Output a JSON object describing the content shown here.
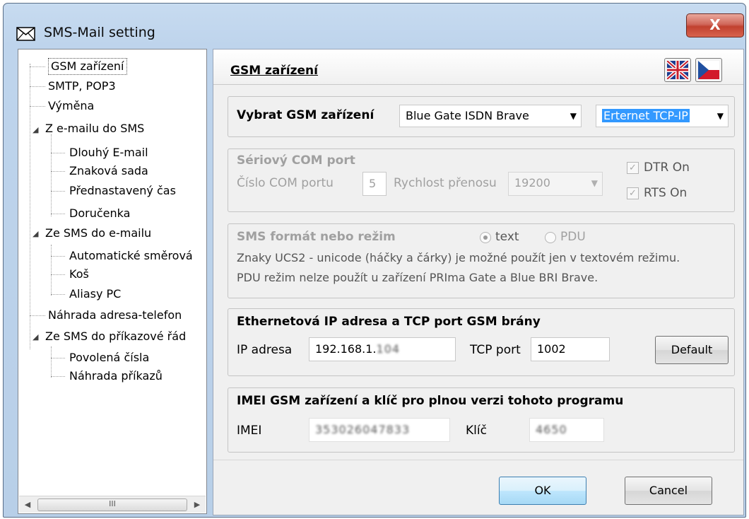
{
  "window": {
    "title": "SMS-Mail setting",
    "close_label": "X"
  },
  "tree": {
    "items": [
      {
        "label": "GSM zařízení"
      },
      {
        "label": "SMTP, POP3"
      },
      {
        "label": "Výměna"
      },
      {
        "label": "Z e-mailu do SMS"
      },
      {
        "label": "Dlouhý E-mail"
      },
      {
        "label": "Znaková sada"
      },
      {
        "label": "Přednastavený čas"
      },
      {
        "label": "Doručenka"
      },
      {
        "label": "Ze SMS do e-mailu"
      },
      {
        "label": "Automatické směrová"
      },
      {
        "label": "Koš"
      },
      {
        "label": "Aliasy PC"
      },
      {
        "label": "Náhrada adresa-telefon"
      },
      {
        "label": "Ze SMS do příkazové řád"
      },
      {
        "label": "Povolená čísla"
      },
      {
        "label": "Náhrada příkazů"
      }
    ],
    "scroll_left": "◀",
    "scroll_thumb": "III",
    "scroll_right": "▶"
  },
  "header": {
    "title": "GSM zařízení",
    "flag_en_icon": "uk-flag-icon",
    "flag_cz_icon": "czech-flag-icon"
  },
  "device": {
    "label": "Vybrat GSM zařízení",
    "device_value": "Blue Gate ISDN Brave",
    "connection_value": "Erternet TCP-IP"
  },
  "serial": {
    "title": "Sériový COM port",
    "com_label": "Číslo COM portu",
    "com_value": "5",
    "speed_label": "Rychlost přenosu",
    "speed_value": "19200",
    "dtr_label": "DTR On",
    "rts_label": "RTS On"
  },
  "sms_format": {
    "title": "SMS formát nebo režim",
    "text_label": "text",
    "pdu_label": "PDU",
    "note1": "Znaky UCS2 - unicode (háčky a čárky) je možné použít jen v textovém režimu.",
    "note2": "PDU režim nelze použít u zařízení PRIma Gate a Blue BRI Brave."
  },
  "ethernet": {
    "title": "Ethernetová IP adresa a TCP port GSM brány",
    "ip_label": "IP adresa",
    "ip_value": "192.168.1.",
    "ip_blurred": "104",
    "tcp_label": "TCP port",
    "tcp_value": "1002",
    "default_label": "Default"
  },
  "imei": {
    "title": "IMEI GSM zařízení a klíč pro plnou verzi tohoto programu",
    "imei_label": "IMEI",
    "imei_value": "353026047833",
    "key_label": "Klíč",
    "key_value": "4650"
  },
  "footer": {
    "ok_label": "OK",
    "cancel_label": "Cancel"
  }
}
